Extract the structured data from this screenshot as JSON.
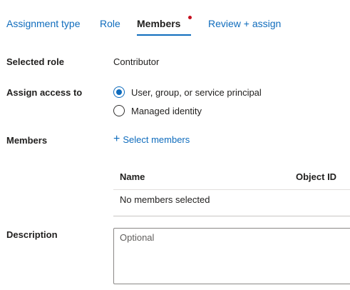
{
  "tabs": [
    {
      "label": "Assignment type",
      "active": false
    },
    {
      "label": "Role",
      "active": false
    },
    {
      "label": "Members",
      "active": true
    },
    {
      "label": "Review + assign",
      "active": false
    }
  ],
  "form": {
    "selected_role": {
      "label": "Selected role",
      "value": "Contributor"
    },
    "assign_access": {
      "label": "Assign access to",
      "options": [
        {
          "label": "User, group, or service principal",
          "checked": true
        },
        {
          "label": "Managed identity",
          "checked": false
        }
      ]
    },
    "members": {
      "label": "Members",
      "select_link": "Select members",
      "columns": [
        "Name",
        "Object ID"
      ],
      "empty_text": "No members selected"
    },
    "description": {
      "label": "Description",
      "placeholder": "Optional",
      "value": ""
    }
  },
  "colors": {
    "accent": "#0f6cbd",
    "text": "#201f1e",
    "dot": "#c50f1f",
    "border": "#8a8886"
  },
  "icons": {
    "add": "plus-icon",
    "unsaved_indicator": "dot-icon"
  }
}
